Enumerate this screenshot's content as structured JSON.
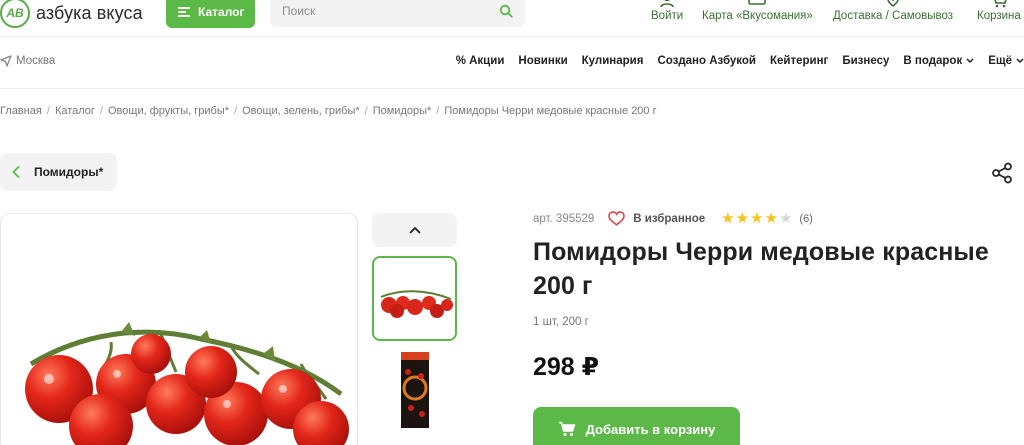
{
  "header": {
    "logo_mark": "АВ",
    "logo_text": "азбука вкуса",
    "catalog_label": "Каталог",
    "search_placeholder": "Поиск",
    "actions": [
      {
        "label": "Войти",
        "icon": "user-icon"
      },
      {
        "label": "Карта «Вкусомания»",
        "icon": "card-icon"
      },
      {
        "label": "Доставка / Самовывоз",
        "icon": "location-pin-icon"
      },
      {
        "label": "Корзина",
        "icon": "cart-icon"
      }
    ]
  },
  "nav": {
    "city": "Москва",
    "links": [
      "% Акции",
      "Новинки",
      "Кулинария",
      "Создано Азбукой",
      "Кейтеринг",
      "Бизнесу",
      "В подарок",
      "Ещё"
    ]
  },
  "breadcrumbs": [
    "Главная",
    "Каталог",
    "Овощи, фрукты, грибы*",
    "Овощи, зелень, грибы*",
    "Помидоры*",
    "Помидоры Черри медовые красные 200 г"
  ],
  "back_label": "Помидоры*",
  "product": {
    "article": "арт. 395529",
    "favorite_label": "В избранное",
    "rating": 4,
    "rating_max": 5,
    "reviews": "(6)",
    "title": "Помидоры Черри медовые красные 200 г",
    "weight": "1 шт, 200 г",
    "price": "298 ₽",
    "add_to_cart": "Добавить в корзину"
  },
  "colors": {
    "brand_green": "#5cb947",
    "star_gold": "#f5c518",
    "star_empty": "#d8d8d8"
  }
}
